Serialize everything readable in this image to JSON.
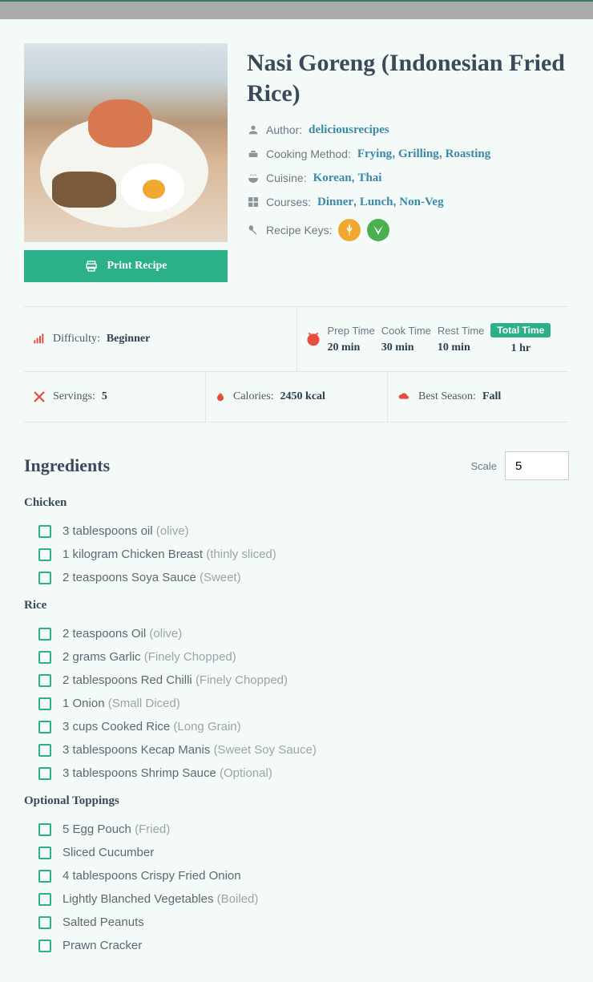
{
  "recipe": {
    "title": "Nasi Goreng (Indonesian Fried Rice)",
    "print_label": "Print Recipe",
    "meta": {
      "author_label": "Author:",
      "author": "deliciousrecipes",
      "method_label": "Cooking Method:",
      "methods": [
        "Frying",
        "Grilling",
        "Roasting"
      ],
      "cuisine_label": "Cuisine:",
      "cuisines": [
        "Korean",
        "Thai"
      ],
      "courses_label": "Courses:",
      "courses": [
        "Dinner",
        "Lunch",
        "Non-Veg"
      ],
      "keys_label": "Recipe Keys:"
    },
    "stats": {
      "difficulty_label": "Difficulty:",
      "difficulty": "Beginner",
      "prep_label": "Prep Time",
      "prep": "20 min",
      "cook_label": "Cook Time",
      "cook": "30 min",
      "rest_label": "Rest Time",
      "rest": "10 min",
      "total_label": "Total Time",
      "total": "1 hr",
      "servings_label": "Servings:",
      "servings": "5",
      "calories_label": "Calories:",
      "calories": "2450 kcal",
      "season_label": "Best Season:",
      "season": "Fall"
    }
  },
  "ingredients": {
    "heading": "Ingredients",
    "scale_label": "Scale",
    "scale_value": "5",
    "groups": [
      {
        "title": "Chicken",
        "items": [
          {
            "text": "3 tablespoons oil",
            "note": "(olive)"
          },
          {
            "text": "1 kilogram Chicken Breast",
            "note": "(thinly sliced)"
          },
          {
            "text": "2 teaspoons Soya Sauce",
            "note": "(Sweet)"
          }
        ]
      },
      {
        "title": "Rice",
        "items": [
          {
            "text": "2 teaspoons Oil",
            "note": "(olive)"
          },
          {
            "text": "2 grams Garlic",
            "note": "(Finely Chopped)"
          },
          {
            "text": "2 tablespoons Red Chilli",
            "note": "(Finely Chopped)"
          },
          {
            "text": "1 Onion",
            "note": "(Small Diced)"
          },
          {
            "text": "3 cups Cooked Rice",
            "note": "(Long Grain)"
          },
          {
            "text": "3 tablespoons Kecap Manis",
            "note": "(Sweet Soy Sauce)"
          },
          {
            "text": "3 tablespoons Shrimp Sauce",
            "note": "(Optional)"
          }
        ]
      },
      {
        "title": "Optional Toppings",
        "items": [
          {
            "text": "5 Egg Pouch",
            "note": "(Fried)"
          },
          {
            "text": "Sliced Cucumber",
            "note": ""
          },
          {
            "text": "4 tablespoons Crispy Fried Onion",
            "note": ""
          },
          {
            "text": "Lightly Blanched Vegetables",
            "note": "(Boiled)"
          },
          {
            "text": "Salted Peanuts",
            "note": ""
          },
          {
            "text": "Prawn Cracker",
            "note": ""
          }
        ]
      }
    ]
  }
}
